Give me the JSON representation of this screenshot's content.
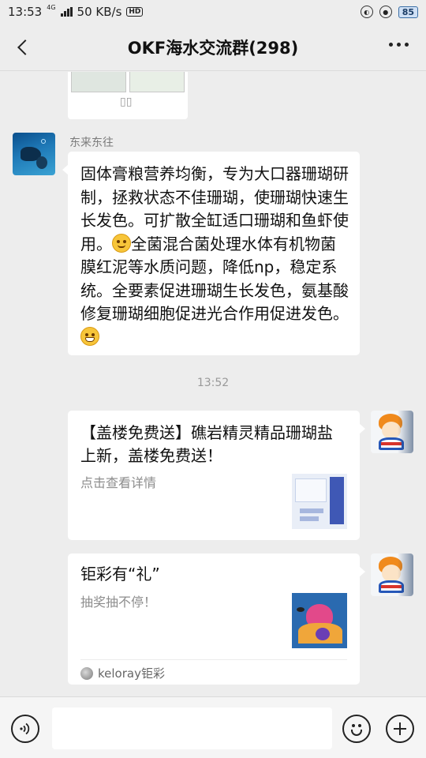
{
  "status_bar": {
    "time": "13:53",
    "network_type": "4G",
    "speed": "50 KB/s",
    "hd_badge": "HD",
    "battery": "85"
  },
  "header": {
    "title": "OKF海水交流群(298)"
  },
  "messages": {
    "msg1": {
      "sender": "东来东往",
      "text_part1": "固体膏粮营养均衡，专为大口器珊瑚研制，拯救状态不佳珊瑚，使珊瑚快速生长发色。可扩散全缸适口珊瑚和鱼虾使用。",
      "text_part2": "全菌混合菌处理水体有机物菌膜红泥等水质问题，降低np，稳定系统。全要素促进珊瑚生长发色，氨基酸修复珊瑚细胞促进光合作用促进发色。"
    },
    "timestamp": "13:52",
    "card1": {
      "title": "【盖楼免费送】礁岩精灵精品珊瑚盐上新，盖楼免费送！",
      "description": "点击查看详情"
    },
    "card2": {
      "title": "钜彩有“礼”",
      "description": "抽奖抽不停！",
      "source": "keloray钜彩"
    }
  },
  "input_bar": {
    "placeholder": ""
  },
  "colors": {
    "background": "#ededed",
    "bubble": "#ffffff",
    "muted_text": "#8c8c8c"
  }
}
